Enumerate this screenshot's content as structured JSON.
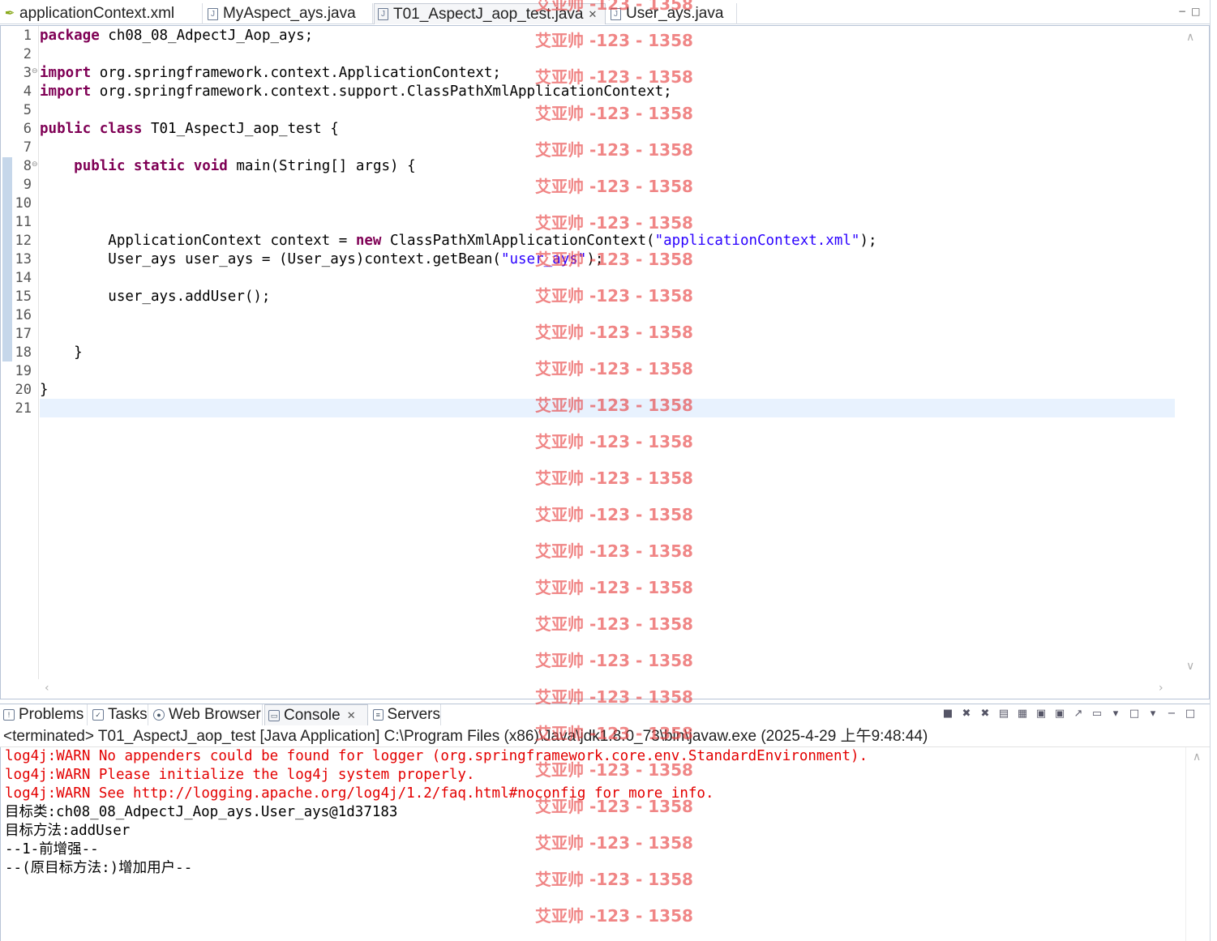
{
  "editor_tabs": [
    {
      "label": "applicationContext.xml",
      "type": "xml",
      "active": false
    },
    {
      "label": "MyAspect_ays.java",
      "type": "java",
      "active": false
    },
    {
      "label": "T01_AspectJ_aop_test.java",
      "type": "java",
      "active": true
    },
    {
      "label": "User_ays.java",
      "type": "java",
      "active": false
    }
  ],
  "editor": {
    "line_numbers": [
      "1",
      "2",
      "3",
      "4",
      "5",
      "6",
      "7",
      "8",
      "9",
      "10",
      "11",
      "12",
      "13",
      "14",
      "15",
      "16",
      "17",
      "18",
      "19",
      "20",
      "21"
    ]
  },
  "code": {
    "l1_kw": "package",
    "l1_rest": " ch08_08_AdpectJ_Aop_ays;",
    "l3_kw": "import",
    "l3_rest": " org.springframework.context.ApplicationContext;",
    "l4_kw": "import",
    "l4_rest": " org.springframework.context.support.ClassPathXmlApplicationContext;",
    "l6_kw1": "public",
    "l6_sp": " ",
    "l6_kw2": "class",
    "l6_rest": " T01_AspectJ_aop_test {",
    "l8_indent": "    ",
    "l8_kw1": "public",
    "l8_kw2": "static",
    "l8_kw3": "void",
    "l8_rest": " main(String[] args) {",
    "l12_pre": "        ApplicationContext context = ",
    "l12_kw": "new",
    "l12_mid": " ClassPathXmlApplicationContext(",
    "l12_str": "\"applicationContext.xml\"",
    "l12_end": ");",
    "l13_pre": "        User_ays user_ays = (User_ays)context.getBean(",
    "l13_str": "\"user_ays\"",
    "l13_end": ");",
    "l15": "        user_ays.addUser();",
    "l18": "    }",
    "l20": "}"
  },
  "panel_tabs": [
    {
      "label": "Problems",
      "icon": "problems-icon"
    },
    {
      "label": "Tasks",
      "icon": "tasks-icon"
    },
    {
      "label": "Web Browser",
      "icon": "globe-icon"
    },
    {
      "label": "Console",
      "icon": "console-icon",
      "active": true
    },
    {
      "label": "Servers",
      "icon": "servers-icon"
    }
  ],
  "console": {
    "header": "<terminated> T01_AspectJ_aop_test [Java Application] C:\\Program Files (x86)\\Java\\jdk1.8.0_73\\bin\\javaw.exe (2025-4-29 上午9:48:44)",
    "lines": [
      {
        "text": "log4j:WARN No appenders could be found for logger (org.springframework.core.env.StandardEnvironment).",
        "kind": "err"
      },
      {
        "text": "log4j:WARN Please initialize the log4j system properly.",
        "kind": "err"
      },
      {
        "text": "log4j:WARN See http://logging.apache.org/log4j/1.2/faq.html#noconfig for more info.",
        "kind": "err"
      },
      {
        "text": "目标类:ch08_08_AdpectJ_Aop_ays.User_ays@1d37183",
        "kind": "out"
      },
      {
        "text": "目标方法:addUser",
        "kind": "out"
      },
      {
        "text": "--1-前增强--",
        "kind": "out"
      },
      {
        "text": "--(原目标方法:)增加用户--",
        "kind": "out"
      }
    ]
  },
  "watermark": {
    "text": "艾亚帅 -123 - 1358",
    "color": "#e63c3c"
  },
  "colors": {
    "keyword": "#7f0055",
    "string": "#2a00ff",
    "error": "#e30000",
    "current_line": "#e8f2fe"
  }
}
